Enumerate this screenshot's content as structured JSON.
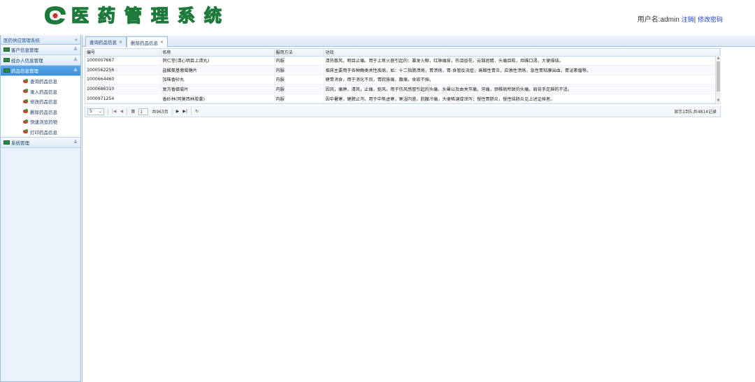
{
  "header": {
    "app_title": "医药管理系统",
    "user_label": "用户名:admin",
    "logout_link": "注销",
    "separator": "|",
    "change_password_link": "修改密码"
  },
  "sidebar": {
    "title": "医药供应管理系统",
    "panels": [
      {
        "label": "客户信息管理",
        "expanded": false
      },
      {
        "label": "经办人信息管理",
        "expanded": false
      },
      {
        "label": "药品信息管理",
        "expanded": true
      },
      {
        "label": "系统管理",
        "expanded": false
      }
    ],
    "drug_items": [
      "查询药品信息",
      "录入药品信息",
      "修改药品信息",
      "删除药品信息",
      "快速浏览药物",
      "打印药品信息"
    ]
  },
  "tabs": [
    {
      "label": "查询药品信息",
      "active": false
    },
    {
      "label": "删除药品信息",
      "active": true
    }
  ],
  "grid": {
    "columns": [
      "编号",
      "名称",
      "服用方法",
      "功效"
    ],
    "rows": [
      [
        "1000007667",
        "同仁堂(清心明目上清丸)",
        "内服",
        "清热散风，明目止痛。用于上焦火盛引起的：暴发火眼，红肿痛痒，热泪昏花，云翳遮睛，头痛目眩，烦躁口渴，大便燥结。"
      ],
      [
        "1000562256",
        "盐酸氨基葡萄糖片",
        "内服",
        "临床主要用于各种酶类关性疾病，如：十二指肠溃疡，胃溃疡，胃-食管反流症，高酸性胃炎，应激性溃疡，急性胃粘膜出血，胃泌素瘤等。"
      ],
      [
        "1000664460",
        "加味香砂丸",
        "内服",
        "健胃消食，用于消化不良，胃脘胀痛，腹痛，食欲不振。"
      ],
      [
        "1000686310",
        "复方香蜡菊片",
        "内服",
        "因风，痛痹，清风，止痛，驱风。用于伤风感冒引起的头痛、头晕以及由关节痛，牙痛，颈椎病所致的头痛，肩背手足麻的不适。"
      ],
      [
        "1000971254",
        "香砂林(阿莫西林胶囊)",
        "内服",
        "因中暑寒，健脾止泻。用于中焦虚寒，寒湿内盛，脘腹冷痛，大便稀溏或泄泻；慢性胃肠炎，慢性结肠炎见上述证候者。"
      ]
    ]
  },
  "pager": {
    "page_size": "5",
    "page_prefix": "第",
    "current_page": "1",
    "page_total": "共963页",
    "info": "显示1到5,共4814记录"
  },
  "icons": {
    "first": "first-page-icon",
    "prev": "prev-page-icon",
    "next": "next-page-icon",
    "last": "last-page-icon",
    "refresh": "refresh-icon"
  },
  "colors": {
    "brand_green": "#1d7a3a",
    "active_panel": "#3b8fd9",
    "link_blue": "#1b3fd1"
  }
}
